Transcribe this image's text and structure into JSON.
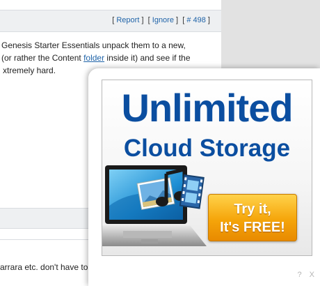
{
  "forum": {
    "post_actions": {
      "report": "Report",
      "ignore": "Ignore",
      "post_number": "# 498"
    },
    "post_text": {
      "line1": "Genesis Starter Essentials unpack them to a new,",
      "line2_before": "(or rather the Content ",
      "line2_link": "folder",
      "line2_after": " inside it) and see if the",
      "line3": "xtremely hard."
    },
    "next_post_text": "arrara etc. don't have to"
  },
  "ad": {
    "headline_1": "Unlimited",
    "headline_2": "Cloud Storage",
    "cta_line1": "Try it,",
    "cta_line2": "It's FREE!",
    "colors": {
      "headline": "#0b4ea0",
      "cta": "#f5a50a"
    }
  },
  "popup": {
    "help_label": "?",
    "close_label": "X"
  }
}
